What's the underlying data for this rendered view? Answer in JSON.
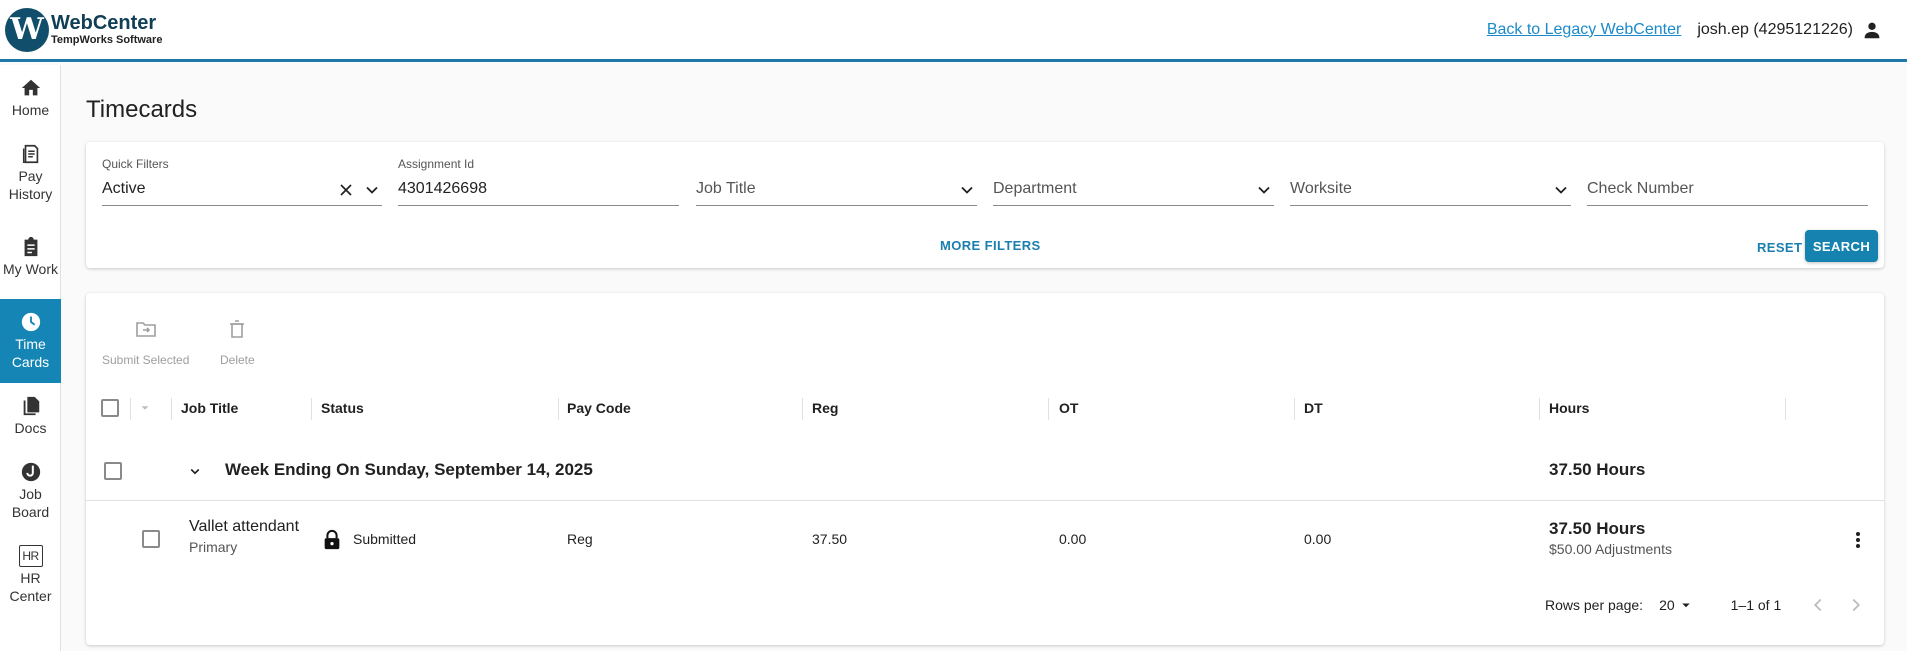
{
  "brand": {
    "logo_letter": "W",
    "name": "WebCenter",
    "subtitle": "TempWorks Software",
    "accent": "#1485b4",
    "dark": "#114e6b"
  },
  "header": {
    "legacy_link": "Back to Legacy WebCenter",
    "user": "josh.ep (4295121226)",
    "user_icon": "person-icon"
  },
  "sidebar": {
    "items": [
      {
        "label": "Home",
        "icon": "home-icon",
        "active": false
      },
      {
        "label": "Pay History",
        "icon": "receipt-icon",
        "active": false
      },
      {
        "label": "My Work",
        "icon": "clipboard-icon",
        "active": false
      },
      {
        "label": "Time Cards",
        "icon": "clock-icon",
        "active": true
      },
      {
        "label": "Docs",
        "icon": "documents-icon",
        "active": false
      },
      {
        "label": "Job Board",
        "icon": "job-board-icon",
        "active": false
      },
      {
        "label": "HR Center",
        "icon": "hr-icon",
        "active": false
      }
    ]
  },
  "page": {
    "title": "Timecards"
  },
  "filters": {
    "quick_filters": {
      "label": "Quick Filters",
      "value": "Active"
    },
    "assignment_id": {
      "label": "Assignment Id",
      "value": "4301426698"
    },
    "job_title": {
      "placeholder": "Job Title"
    },
    "department": {
      "placeholder": "Department"
    },
    "worksite": {
      "placeholder": "Worksite"
    },
    "check_number": {
      "placeholder": "Check Number"
    },
    "more_filters": "MORE FILTERS",
    "reset": "RESET",
    "search": "SEARCH"
  },
  "toolbar": {
    "submit_selected": "Submit Selected",
    "delete": "Delete"
  },
  "table": {
    "columns": [
      "Job Title",
      "Status",
      "Pay Code",
      "Reg",
      "OT",
      "DT",
      "Hours"
    ],
    "group": {
      "title": "Week Ending On Sunday, September 14, 2025",
      "hours": "37.50 Hours"
    },
    "rows": [
      {
        "job_title": "Vallet attendant",
        "job_sub": "Primary",
        "status": "Submitted",
        "pay_code": "Reg",
        "reg": "37.50",
        "ot": "0.00",
        "dt": "0.00",
        "hours": "37.50 Hours",
        "adjustments": "$50.00 Adjustments"
      }
    ]
  },
  "pagination": {
    "rows_per_page_label": "Rows per page:",
    "rows_per_page": "20",
    "range": "1–1 of 1"
  }
}
